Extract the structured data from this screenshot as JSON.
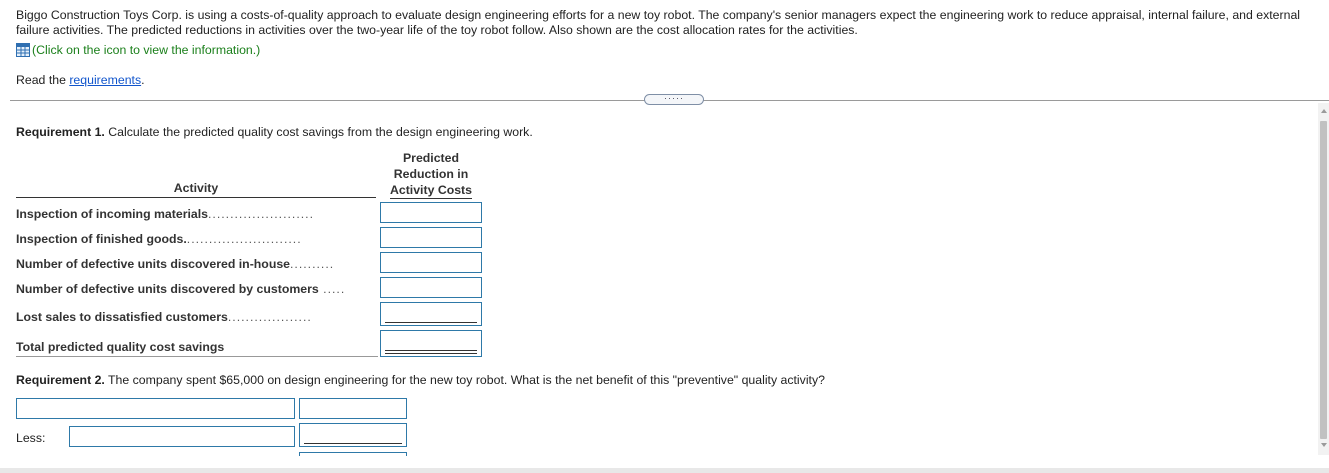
{
  "intro": {
    "text": "Biggo Construction Toys Corp. is using a costs-of-quality approach to evaluate design engineering efforts for a new toy robot. The company's senior managers expect the engineering work to reduce appraisal, internal failure, and external failure activities. The predicted reductions in activities over the two-year life of the toy robot follow. Also shown are the cost allocation rates for the activities.",
    "click_text": "(Click on the icon to view the information.)",
    "read_prefix": "Read the ",
    "read_link": "requirements",
    "read_suffix": "."
  },
  "more_button": "·····",
  "requirement1": {
    "label": "Requirement 1.",
    "text": " Calculate the predicted quality cost savings from the design engineering work.",
    "col_activity": "Activity",
    "col_reduction_line1": "Predicted",
    "col_reduction_line2": "Reduction in",
    "col_reduction_line3": "Activity Costs",
    "rows": [
      {
        "label": "Inspection of incoming materials",
        "dots": "........................"
      },
      {
        "label": "Inspection of finished goods.",
        "dots": ".........................."
      },
      {
        "label": "Number of defective units discovered in-house",
        "dots": ".........."
      },
      {
        "label": "Number of defective units discovered by customers",
        "dots": " ....."
      },
      {
        "label": "Lost sales to dissatisfied customers",
        "dots": "..................."
      }
    ],
    "total_label": "Total predicted quality cost savings"
  },
  "requirement2": {
    "label": "Requirement 2.",
    "text": " The company spent $65,000 on design engineering for the new toy robot. What is the net benefit of this \"preventive\" quality activity?",
    "less_label": "Less:"
  }
}
